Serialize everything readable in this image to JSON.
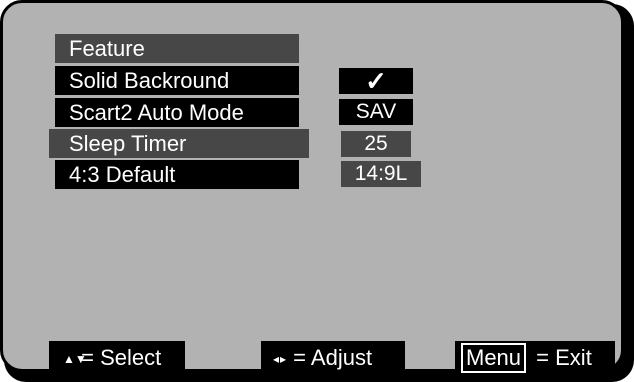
{
  "menu": {
    "title": "Feature",
    "items": [
      {
        "label": "Solid Backround",
        "value": "✓"
      },
      {
        "label": "Scart2 Auto Mode",
        "value": "SAV"
      },
      {
        "label": "Sleep Timer",
        "value": "25"
      },
      {
        "label": "4:3 Default",
        "value": "14:9L"
      }
    ],
    "selected_index": 2
  },
  "footer": {
    "select_icon": "up-down-arrows-icon",
    "select_glyph": "▲▼",
    "select_label": "= Select",
    "adjust_icon": "left-right-arrows-icon",
    "adjust_glyph": "◂▸",
    "adjust_label": "= Adjust",
    "menu_key": "Menu",
    "exit_label": "= Exit"
  },
  "colors": {
    "panel": "#b2b2b2",
    "item_bg": "#000000",
    "highlight_bg": "#474747",
    "text": "#ffffff"
  }
}
